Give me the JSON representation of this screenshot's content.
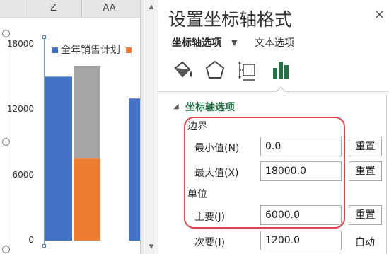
{
  "sheet": {
    "columns": [
      "Z",
      "AA"
    ],
    "y_ticks": [
      "18000",
      "12000",
      "6000",
      "0"
    ],
    "legend": {
      "label": "全年销售计划",
      "color": "#4472c4",
      "second_color": "#ed7d31"
    }
  },
  "chart_data": {
    "type": "bar",
    "yaxis_ticks": [
      0,
      6000,
      12000,
      18000
    ],
    "ylim": [
      0,
      18000
    ],
    "series": [
      {
        "name": "全年销售计划",
        "color": "#4472c4",
        "values": [
          15000,
          null,
          13000
        ]
      },
      {
        "color": "#ed7d31",
        "values": [
          null,
          7500,
          null
        ]
      },
      {
        "color": "#a5a5a5",
        "values": [
          null,
          8500,
          null
        ]
      }
    ],
    "stacked_second_bar": true
  },
  "pane": {
    "title": "设置坐标轴格式",
    "close": "×",
    "tab_axis_options": "坐标轴选项",
    "tab_axis_arrow": "▼",
    "tab_text_options": "文本选项",
    "icons": [
      "fill-line-icon",
      "effects-pentagon-icon",
      "size-properties-icon",
      "axis-options-bar-icon"
    ],
    "section_title": "坐标轴选项",
    "section_arrow": "◢",
    "bounds_label": "边界",
    "units_label": "单位",
    "min_label": "最小值(N)",
    "min_value": "0.0",
    "max_label": "最大值(X)",
    "max_value": "18000.0",
    "major_label": "主要(J)",
    "major_value": "6000.0",
    "minor_label": "次要(I)",
    "minor_value": "1200.0",
    "reset_label": "重置",
    "auto_label": "自动",
    "highlight_color": "#e2414a",
    "accent_color": "#217346"
  }
}
